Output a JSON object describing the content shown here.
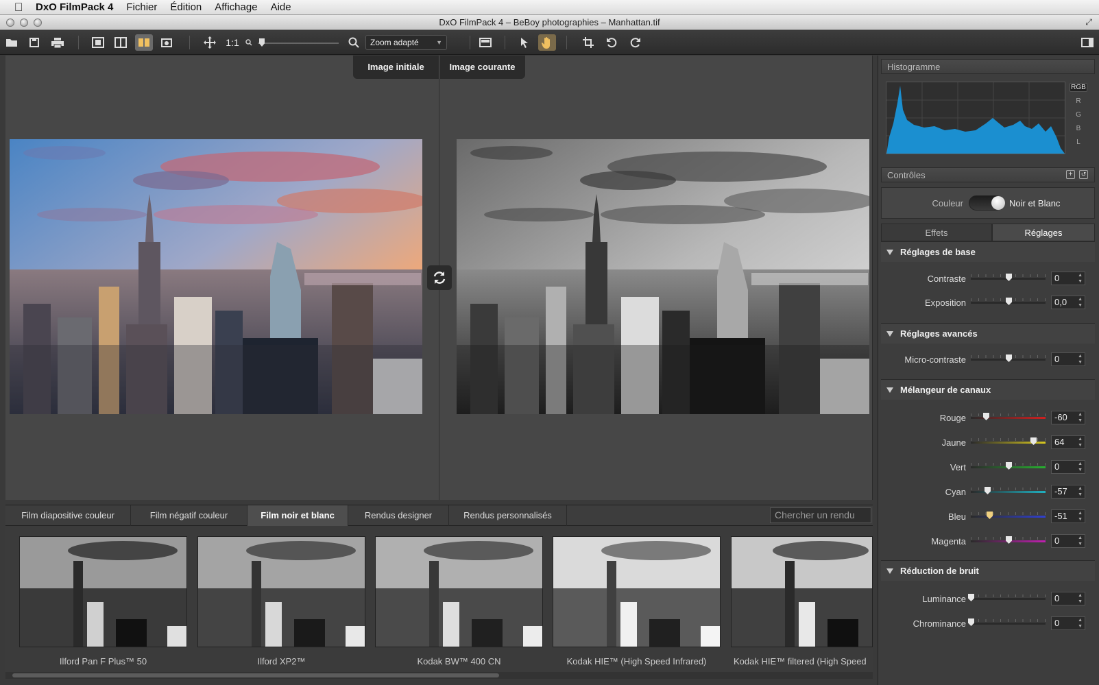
{
  "menubar": {
    "app": "DxO FilmPack 4",
    "items": [
      "Fichier",
      "Édition",
      "Affichage",
      "Aide"
    ]
  },
  "window": {
    "title": "DxO FilmPack 4 – BeBoy photographies – Manhattan.tif"
  },
  "toolbar": {
    "zoom_ratio_label": "1:1",
    "zoom_select_value": "Zoom adapté"
  },
  "viewer": {
    "compare_left": "Image initiale",
    "compare_right": "Image courante"
  },
  "film_tabs": {
    "tabs": [
      "Film diapositive couleur",
      "Film négatif couleur",
      "Film noir et blanc",
      "Rendus designer",
      "Rendus personnalisés"
    ],
    "selected": "Film noir et blanc",
    "search_placeholder": "Chercher un rendu"
  },
  "thumbnails": [
    {
      "label": "Ilford Pan F Plus™ 50"
    },
    {
      "label": "Ilford XP2™"
    },
    {
      "label": "Kodak BW™ 400 CN"
    },
    {
      "label": "Kodak HIE™ (High Speed Infrared)"
    },
    {
      "label": "Kodak HIE™ filtered (High Speed"
    }
  ],
  "panel": {
    "histogram": {
      "title": "Histogramme",
      "channels": [
        "RGB",
        "R",
        "G",
        "B",
        "L"
      ],
      "selected_channel": "RGB",
      "fill_color": "#1b8fd0"
    },
    "controls": {
      "title": "Contrôles",
      "mode_left": "Couleur",
      "mode_right": "Noir et Blanc",
      "mode_on": true,
      "tab_effets": "Effets",
      "tab_reglages": "Réglages",
      "selected_tab": "Réglages"
    },
    "sections": {
      "base": {
        "title": "Réglages de base",
        "sliders": [
          {
            "label": "Contraste",
            "value": "0"
          },
          {
            "label": "Exposition",
            "value": "0,0"
          }
        ]
      },
      "advanced": {
        "title": "Réglages avancés",
        "sliders": [
          {
            "label": "Micro-contraste",
            "value": "0"
          }
        ]
      },
      "mixer": {
        "title": "Mélangeur de canaux",
        "sliders": [
          {
            "label": "Rouge",
            "value": "-60",
            "color": "#d12020"
          },
          {
            "label": "Jaune",
            "value": "64",
            "color": "#d8c820"
          },
          {
            "label": "Vert",
            "value": "0",
            "color": "#28b030"
          },
          {
            "label": "Cyan",
            "value": "-57",
            "color": "#20b0c0"
          },
          {
            "label": "Bleu",
            "value": "-51",
            "color": "#3040d0"
          },
          {
            "label": "Magenta",
            "value": "0",
            "color": "#c020b0"
          }
        ]
      },
      "noise": {
        "title": "Réduction de bruit",
        "sliders": [
          {
            "label": "Luminance",
            "value": "0"
          },
          {
            "label": "Chrominance",
            "value": "0"
          }
        ]
      }
    }
  }
}
